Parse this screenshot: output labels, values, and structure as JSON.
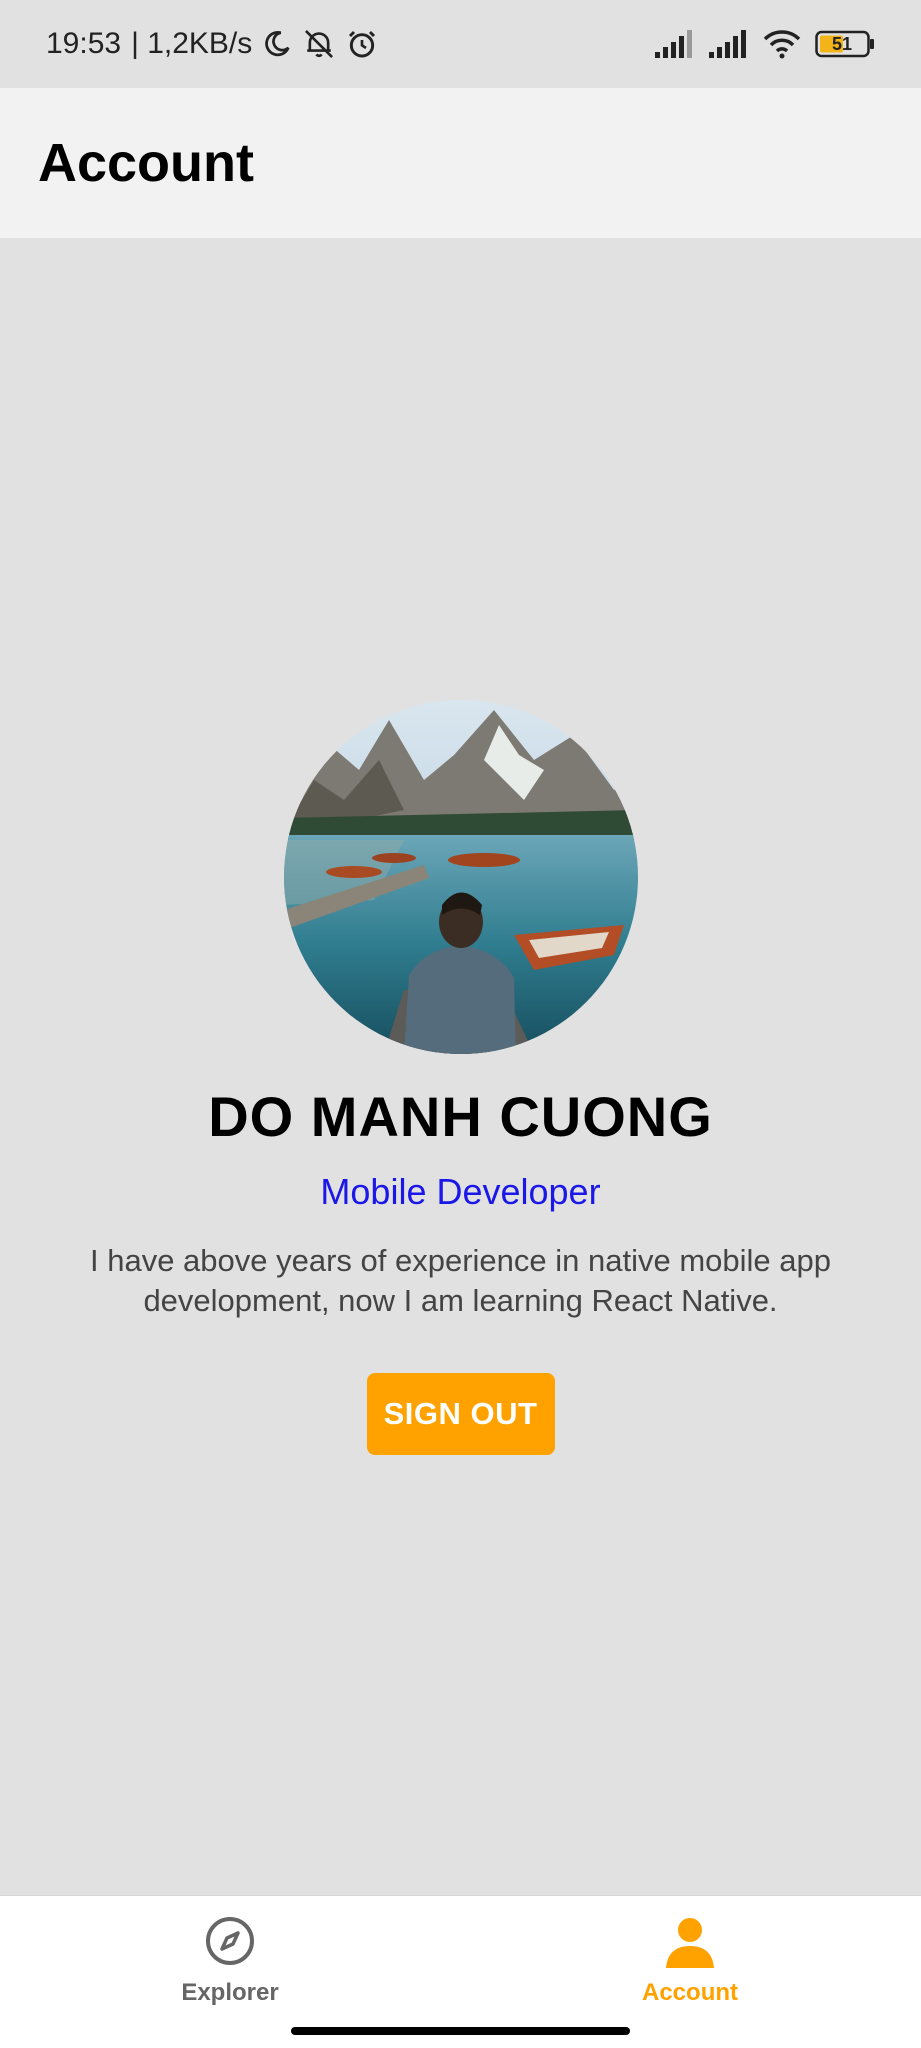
{
  "status_bar": {
    "time": "19:53",
    "network_speed": "| 1,2KB/s",
    "battery_level": "51",
    "icons": [
      "moon-icon",
      "muted-bell-icon",
      "alarm-icon",
      "signal-icon",
      "signal-icon",
      "wifi-icon",
      "battery-icon"
    ]
  },
  "header": {
    "title": "Account"
  },
  "profile": {
    "name": "DO MANH CUONG",
    "role": "Mobile Developer",
    "bio": "I have above years of experience in native mobile app development, now I am learning React Native.",
    "sign_out_label": "SIGN OUT"
  },
  "tabbar": {
    "tabs": [
      {
        "label": "Explorer",
        "icon": "compass-icon",
        "active": false
      },
      {
        "label": "Account",
        "icon": "person-icon",
        "active": true
      }
    ]
  },
  "colors": {
    "accent": "#ffa200",
    "role_text": "#1a17e8",
    "background": "#e1e1e1",
    "header_background": "#f2f2f2"
  }
}
